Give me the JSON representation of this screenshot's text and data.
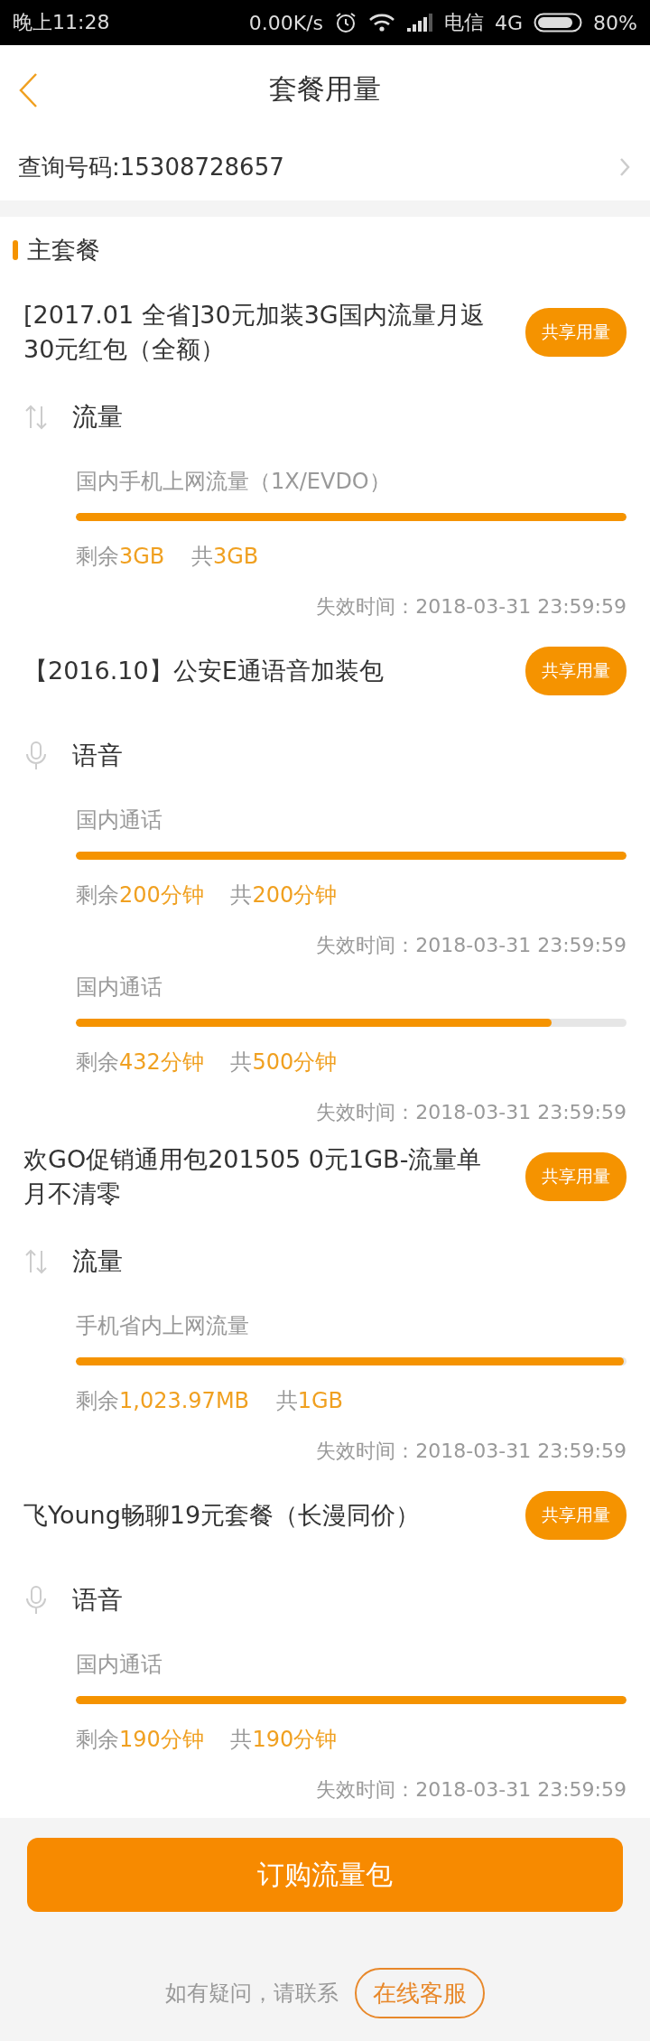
{
  "status_bar": {
    "time": "晚上11:28",
    "speed": "0.00K/s",
    "carrier": "电信",
    "network": "4G",
    "battery": "80%"
  },
  "header": {
    "title": "套餐用量"
  },
  "query": {
    "label": "查询号码:15308728657"
  },
  "section": {
    "title": "主套餐"
  },
  "packages": [
    {
      "title": "[2017.01 全省]30元加装3G国内流量月返30元红包（全额）",
      "badge": "共享用量",
      "services": [
        {
          "kind": "data",
          "name": "流量",
          "items": [
            {
              "label": "国内手机上网流量（1X/EVDO）",
              "level": 1,
              "remaining_label": "剩余",
              "remaining": "3GB",
              "total_label": "共",
              "total": "3GB",
              "expire": "失效时间：2018-03-31 23:59:59"
            }
          ]
        }
      ]
    },
    {
      "title": "【2016.10】公安E通语音加装包",
      "badge": "共享用量",
      "services": [
        {
          "kind": "voice",
          "name": "语音",
          "items": [
            {
              "label": "国内通话",
              "level": 1,
              "remaining_label": "剩余",
              "remaining": "200分钟",
              "total_label": "共",
              "total": "200分钟",
              "expire": "失效时间：2018-03-31 23:59:59"
            },
            {
              "label": "国内通话",
              "level": 0.864,
              "remaining_label": "剩余",
              "remaining": "432分钟",
              "total_label": "共",
              "total": "500分钟",
              "expire": "失效时间：2018-03-31 23:59:59"
            }
          ]
        }
      ]
    },
    {
      "title": "欢GO促销通用包201505 0元1GB-流量单月不清零",
      "badge": "共享用量",
      "services": [
        {
          "kind": "data",
          "name": "流量",
          "items": [
            {
              "label": "手机省内上网流量",
              "level": 0.995,
              "remaining_label": "剩余",
              "remaining": "1,023.97MB",
              "total_label": "共",
              "total": "1GB",
              "expire": "失效时间：2018-03-31 23:59:59"
            }
          ]
        }
      ]
    },
    {
      "title": "飞Young畅聊19元套餐（长漫同价）",
      "badge": "共享用量",
      "services": [
        {
          "kind": "voice",
          "name": "语音",
          "items": [
            {
              "label": "国内通话",
              "level": 1,
              "remaining_label": "剩余",
              "remaining": "190分钟",
              "total_label": "共",
              "total": "190分钟",
              "expire": "失效时间：2018-03-31 23:59:59"
            }
          ]
        }
      ]
    }
  ],
  "order_button": "订购流量包",
  "footer": {
    "text": "如有疑问，请联系",
    "link": "在线客服"
  }
}
